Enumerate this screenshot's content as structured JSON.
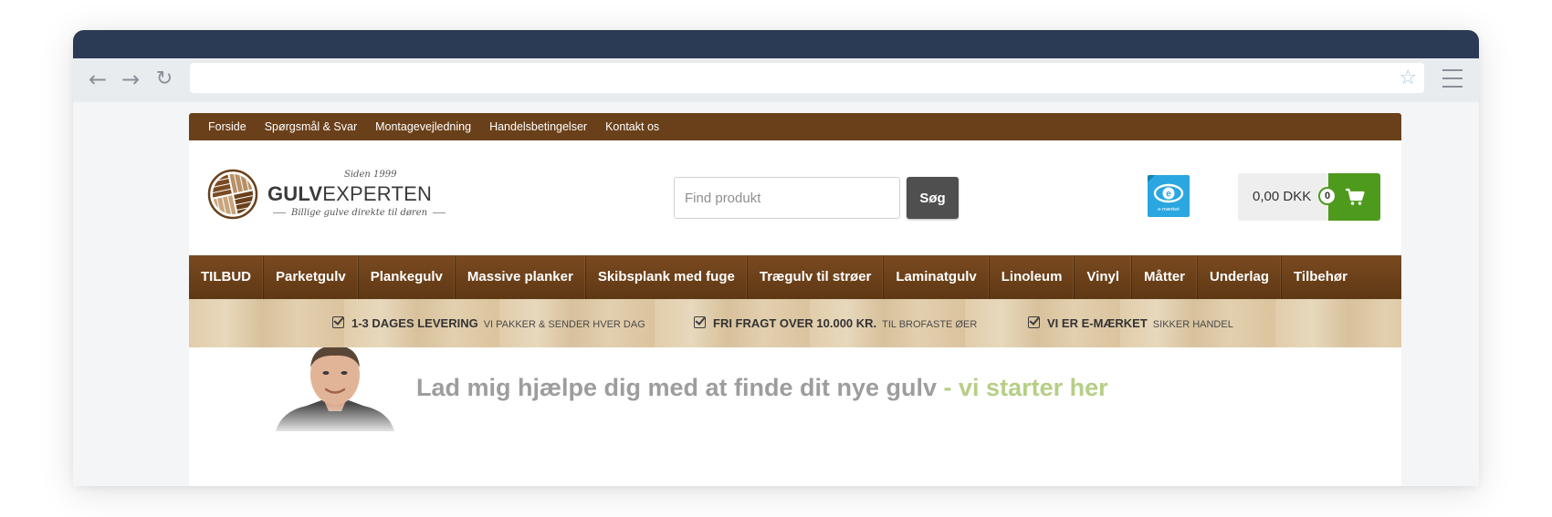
{
  "top_nav": [
    "Forside",
    "Spørgsmål & Svar",
    "Montagevejledning",
    "Handelsbetingelser",
    "Kontakt os"
  ],
  "logo": {
    "since": "Siden 1999",
    "name_bold": "GULV",
    "name_light": "EXPERTEN",
    "tagline": "Billige gulve direkte til døren"
  },
  "search": {
    "placeholder": "Find produkt",
    "button": "Søg"
  },
  "emaerket": {
    "label": "e-mærket"
  },
  "cart": {
    "price": "0,00 DKK",
    "count": "0"
  },
  "main_nav": [
    "TILBUD",
    "Parketgulv",
    "Plankegulv",
    "Massive planker",
    "Skibsplank med fuge",
    "Trægulv til strøer",
    "Laminatgulv",
    "Linoleum",
    "Vinyl",
    "Måtter",
    "Underlag",
    "Tilbehør"
  ],
  "usps": [
    {
      "bold": "1-3 DAGES LEVERING",
      "light": "VI PAKKER & SENDER HVER DAG"
    },
    {
      "bold": "FRI FRAGT OVER 10.000 KR.",
      "light": "TIL BROFASTE ØER"
    },
    {
      "bold": "VI ER E-MÆRKET",
      "light": "SIKKER HANDEL"
    }
  ],
  "hero": {
    "text_gray": "Lad mig hjælpe dig med at finde dit nye gulv",
    "text_green": " - vi starter her"
  },
  "colors": {
    "brand_brown": "#6a401a",
    "chrome_title": "#2b3a55",
    "cart_green": "#4d9a1d",
    "hero_green": "#b5cf85",
    "emaerket_blue": "#2aa7e0"
  },
  "icons": [
    "back-arrow-icon",
    "forward-arrow-icon",
    "reload-icon",
    "star-icon",
    "menu-icon",
    "checkbox-check-icon",
    "shopping-cart-icon",
    "e-maerket-eye-icon"
  ]
}
